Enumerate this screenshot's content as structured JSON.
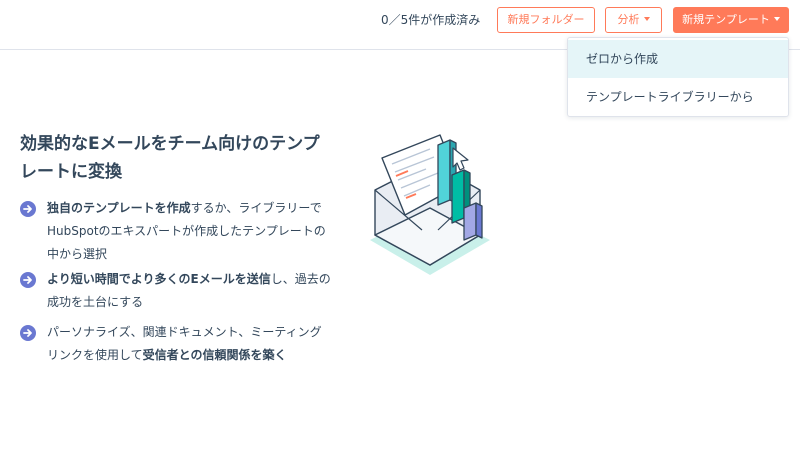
{
  "header": {
    "count_text": "0／5件が作成済み",
    "new_folder_label": "新規フォルダー",
    "analytics_label": "分析",
    "new_template_label": "新規テンプレート"
  },
  "dropdown": {
    "items": [
      {
        "label": "ゼロから作成"
      },
      {
        "label": "テンプレートライブラリーから"
      }
    ]
  },
  "main": {
    "headline": "効果的なEメールをチーム向けのテンプレートに変換",
    "bullets": [
      {
        "bold": "独自のテンプレートを作成",
        "rest": "するか、ライブラリーでHubSpotのエキスパートが作成したテンプレートの中から選択"
      },
      {
        "bold": "より短い時間でより多くのEメールを送信",
        "rest": "し、過去の成功を土台にする"
      },
      {
        "pre": "パーソナライズ、関連ドキュメント、ミーティングリンクを使用して",
        "bold": "受信者との信頼関係を築く"
      }
    ]
  },
  "colors": {
    "accent": "#ff7a59",
    "text": "#33475b",
    "bullet": "#6a78d1",
    "dropdown_active": "#e5f5f8"
  },
  "icons": {
    "bullet": "arrow-right-icon",
    "caret": "caret-down-icon",
    "illustration": "email-template-chart-illustration"
  }
}
